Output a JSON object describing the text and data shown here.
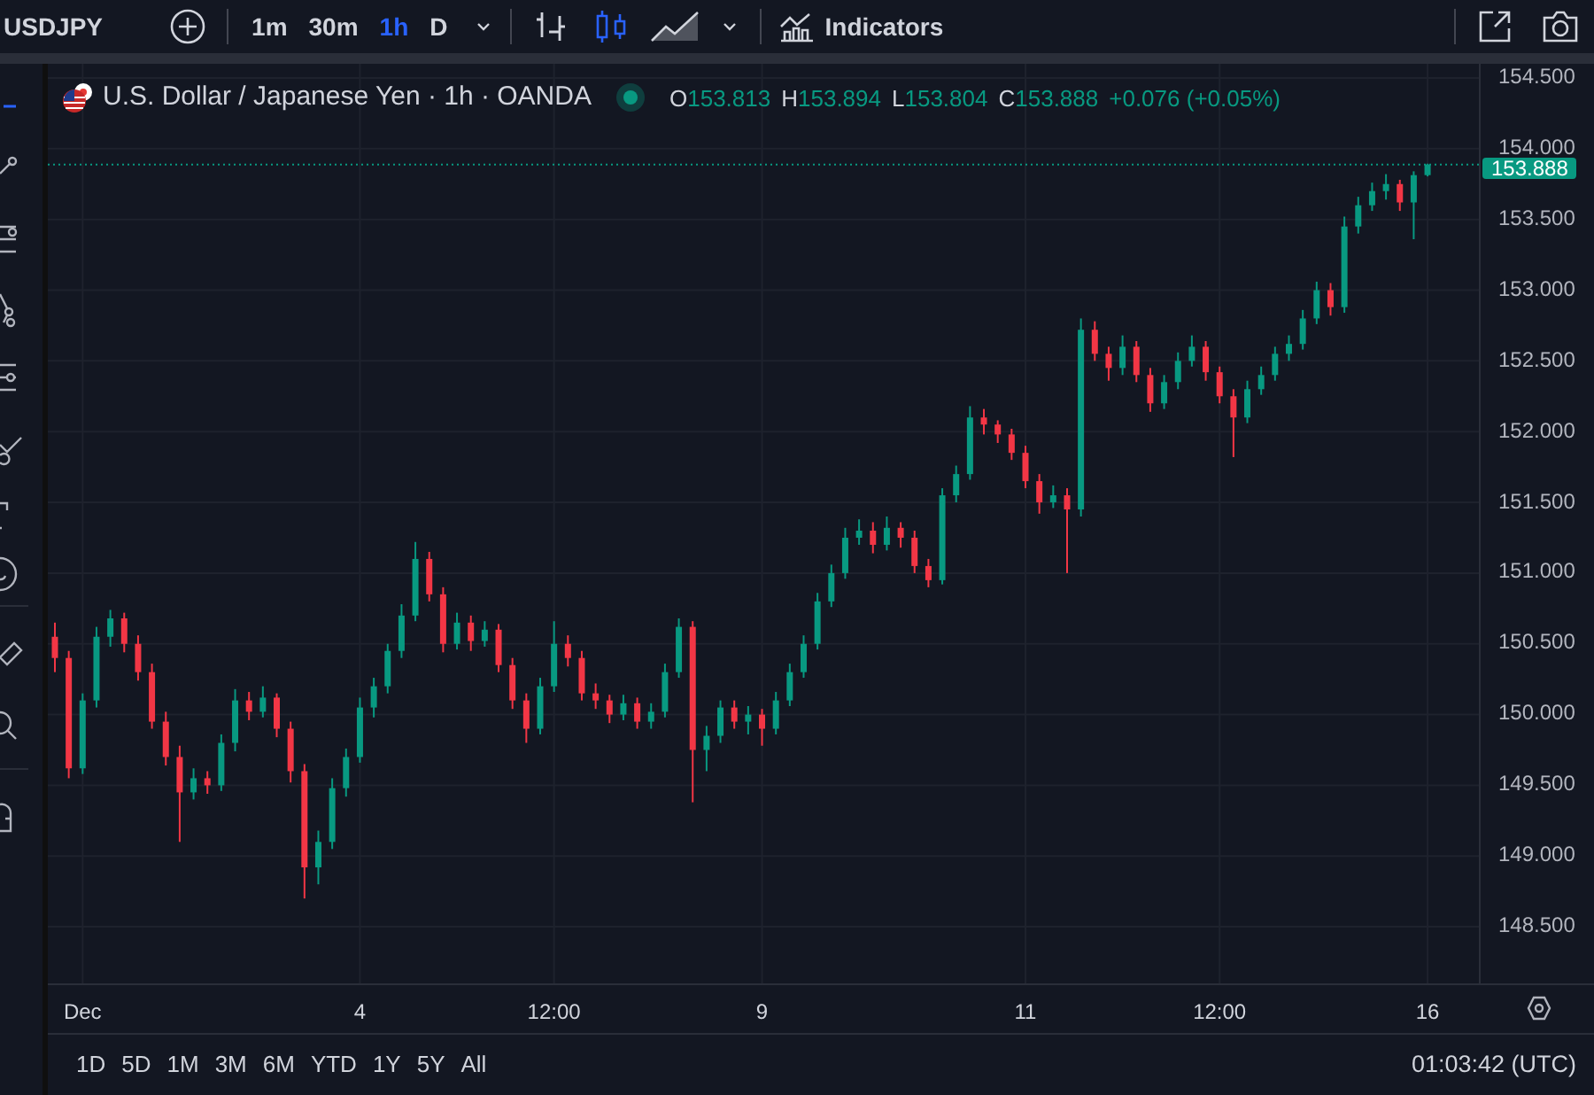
{
  "symbol": "USDJPY",
  "intervals": [
    {
      "label": "1m",
      "selected": false
    },
    {
      "label": "30m",
      "selected": false
    },
    {
      "label": "1h",
      "selected": true
    },
    {
      "label": "D",
      "selected": false
    }
  ],
  "chart_styles": [
    {
      "kind": "bars",
      "selected": false
    },
    {
      "kind": "candles",
      "selected": true
    },
    {
      "kind": "area",
      "selected": false
    }
  ],
  "indicators_button": "Indicators",
  "legend": {
    "title": "U.S. Dollar / Japanese Yen · 1h · OANDA",
    "market_open": true,
    "ohlc": [
      {
        "label": "O",
        "value": "153.813"
      },
      {
        "label": "H",
        "value": "153.894"
      },
      {
        "label": "L",
        "value": "153.804"
      },
      {
        "label": "C",
        "value": "153.888"
      }
    ],
    "change": "+0.076 (+0.05%)"
  },
  "chart": {
    "chart_data": {
      "type": "candlestick",
      "ylim": [
        148.1,
        154.6
      ],
      "grid": true,
      "ref_lines": [
        {
          "axis": "y",
          "value": 153.888,
          "label": "153.888",
          "color": "#089981"
        }
      ],
      "yticks": [
        {
          "value": 154.5,
          "label": "154.500"
        },
        {
          "value": 154,
          "label": "154.000"
        },
        {
          "value": 153.5,
          "label": "153.500"
        },
        {
          "value": 153,
          "label": "153.000"
        },
        {
          "value": 152.5,
          "label": "152.500"
        },
        {
          "value": 152,
          "label": "152.000"
        },
        {
          "value": 151.5,
          "label": "151.500"
        },
        {
          "value": 151,
          "label": "151.000"
        },
        {
          "value": 150.5,
          "label": "150.500"
        },
        {
          "value": 150,
          "label": "150.000"
        },
        {
          "value": 149.5,
          "label": "149.500"
        },
        {
          "value": 149,
          "label": "149.000"
        },
        {
          "value": 148.5,
          "label": "148.500"
        }
      ],
      "categories": [
        null,
        null,
        "Dec",
        null,
        null,
        null,
        null,
        null,
        null,
        null,
        null,
        null,
        null,
        null,
        null,
        null,
        null,
        null,
        null,
        null,
        null,
        null,
        "4",
        null,
        null,
        null,
        null,
        null,
        null,
        null,
        null,
        null,
        null,
        null,
        null,
        null,
        "12:00",
        null,
        null,
        null,
        null,
        null,
        null,
        null,
        null,
        null,
        null,
        null,
        null,
        null,
        null,
        "9",
        null,
        null,
        null,
        null,
        null,
        null,
        null,
        null,
        null,
        null,
        null,
        null,
        null,
        null,
        null,
        null,
        null,
        null,
        "11",
        null,
        null,
        null,
        null,
        null,
        null,
        null,
        null,
        null,
        null,
        null,
        null,
        null,
        "12:00",
        null,
        null,
        null,
        null,
        null,
        null,
        null,
        null,
        null,
        null,
        null,
        null,
        null,
        null,
        "16"
      ],
      "ohlc": [
        [
          150.55,
          150.65,
          150.3,
          150.4
        ],
        [
          150.4,
          150.45,
          149.55,
          149.62
        ],
        [
          149.62,
          150.15,
          149.58,
          150.1
        ],
        [
          150.1,
          150.62,
          150.05,
          150.55
        ],
        [
          150.55,
          150.74,
          150.48,
          150.68
        ],
        [
          150.68,
          150.72,
          150.44,
          150.5
        ],
        [
          150.5,
          150.56,
          150.24,
          150.3
        ],
        [
          150.3,
          150.36,
          149.9,
          149.95
        ],
        [
          149.95,
          150.02,
          149.64,
          149.7
        ],
        [
          149.7,
          149.78,
          149.1,
          149.45
        ],
        [
          149.45,
          149.62,
          149.4,
          149.55
        ],
        [
          149.55,
          149.6,
          149.44,
          149.5
        ],
        [
          149.5,
          149.86,
          149.46,
          149.8
        ],
        [
          149.8,
          150.18,
          149.74,
          150.1
        ],
        [
          150.1,
          150.16,
          149.96,
          150.02
        ],
        [
          150.02,
          150.2,
          149.98,
          150.12
        ],
        [
          150.12,
          150.15,
          149.84,
          149.9
        ],
        [
          149.9,
          149.95,
          149.52,
          149.6
        ],
        [
          149.6,
          149.65,
          148.7,
          148.92
        ],
        [
          148.92,
          149.18,
          148.8,
          149.1
        ],
        [
          149.1,
          149.55,
          149.05,
          149.48
        ],
        [
          149.48,
          149.76,
          149.42,
          149.7
        ],
        [
          149.7,
          150.12,
          149.66,
          150.05
        ],
        [
          150.05,
          150.26,
          149.98,
          150.2
        ],
        [
          150.2,
          150.5,
          150.15,
          150.45
        ],
        [
          150.45,
          150.78,
          150.4,
          150.7
        ],
        [
          150.7,
          151.22,
          150.66,
          151.1
        ],
        [
          151.1,
          151.15,
          150.8,
          150.85
        ],
        [
          150.85,
          150.9,
          150.44,
          150.5
        ],
        [
          150.5,
          150.72,
          150.46,
          150.65
        ],
        [
          150.65,
          150.7,
          150.45,
          150.52
        ],
        [
          150.52,
          150.66,
          150.48,
          150.6
        ],
        [
          150.6,
          150.64,
          150.3,
          150.35
        ],
        [
          150.35,
          150.4,
          150.04,
          150.1
        ],
        [
          150.1,
          150.15,
          149.8,
          149.9
        ],
        [
          149.9,
          150.26,
          149.86,
          150.2
        ],
        [
          150.2,
          150.66,
          150.16,
          150.5
        ],
        [
          150.5,
          150.56,
          150.34,
          150.4
        ],
        [
          150.4,
          150.45,
          150.1,
          150.15
        ],
        [
          150.15,
          150.22,
          150.04,
          150.1
        ],
        [
          150.1,
          150.14,
          149.94,
          150.0
        ],
        [
          150.0,
          150.14,
          149.96,
          150.08
        ],
        [
          150.08,
          150.12,
          149.9,
          149.95
        ],
        [
          149.95,
          150.08,
          149.9,
          150.02
        ],
        [
          150.02,
          150.36,
          149.98,
          150.3
        ],
        [
          150.3,
          150.68,
          150.26,
          150.62
        ],
        [
          150.62,
          150.66,
          149.38,
          149.75
        ],
        [
          149.75,
          149.92,
          149.6,
          149.85
        ],
        [
          149.85,
          150.1,
          149.8,
          150.05
        ],
        [
          150.05,
          150.1,
          149.9,
          149.95
        ],
        [
          149.95,
          150.06,
          149.86,
          150.0
        ],
        [
          150.0,
          150.04,
          149.78,
          149.9
        ],
        [
          149.9,
          150.16,
          149.86,
          150.1
        ],
        [
          150.1,
          150.36,
          150.06,
          150.3
        ],
        [
          150.3,
          150.56,
          150.26,
          150.5
        ],
        [
          150.5,
          150.86,
          150.46,
          150.8
        ],
        [
          150.8,
          151.06,
          150.76,
          151.0
        ],
        [
          151.0,
          151.32,
          150.96,
          151.25
        ],
        [
          151.25,
          151.38,
          151.2,
          151.3
        ],
        [
          151.3,
          151.36,
          151.14,
          151.2
        ],
        [
          151.2,
          151.4,
          151.16,
          151.32
        ],
        [
          151.32,
          151.36,
          151.18,
          151.25
        ],
        [
          151.25,
          151.3,
          151.0,
          151.05
        ],
        [
          151.05,
          151.1,
          150.9,
          150.95
        ],
        [
          150.95,
          151.6,
          150.92,
          151.55
        ],
        [
          151.55,
          151.76,
          151.5,
          151.7
        ],
        [
          151.7,
          152.18,
          151.66,
          152.1
        ],
        [
          152.1,
          152.16,
          151.98,
          152.05
        ],
        [
          152.05,
          152.08,
          151.92,
          151.98
        ],
        [
          151.98,
          152.02,
          151.8,
          151.85
        ],
        [
          151.85,
          151.9,
          151.6,
          151.65
        ],
        [
          151.65,
          151.7,
          151.42,
          151.5
        ],
        [
          151.5,
          151.62,
          151.46,
          151.55
        ],
        [
          151.55,
          151.6,
          151.0,
          151.45
        ],
        [
          151.45,
          152.8,
          151.4,
          152.72
        ],
        [
          152.72,
          152.78,
          152.5,
          152.55
        ],
        [
          152.55,
          152.6,
          152.36,
          152.45
        ],
        [
          152.45,
          152.68,
          152.4,
          152.6
        ],
        [
          152.6,
          152.64,
          152.35,
          152.4
        ],
        [
          152.4,
          152.45,
          152.14,
          152.2
        ],
        [
          152.2,
          152.4,
          152.16,
          152.35
        ],
        [
          152.35,
          152.56,
          152.3,
          152.5
        ],
        [
          152.5,
          152.68,
          152.46,
          152.6
        ],
        [
          152.6,
          152.64,
          152.36,
          152.42
        ],
        [
          152.42,
          152.46,
          152.2,
          152.25
        ],
        [
          152.25,
          152.3,
          151.82,
          152.1
        ],
        [
          152.1,
          152.36,
          152.06,
          152.3
        ],
        [
          152.3,
          152.46,
          152.26,
          152.4
        ],
        [
          152.4,
          152.6,
          152.36,
          152.55
        ],
        [
          152.55,
          152.68,
          152.5,
          152.62
        ],
        [
          152.62,
          152.86,
          152.58,
          152.8
        ],
        [
          152.8,
          153.06,
          152.76,
          153.0
        ],
        [
          153.0,
          153.05,
          152.82,
          152.88
        ],
        [
          152.88,
          153.52,
          152.84,
          153.45
        ],
        [
          153.45,
          153.66,
          153.4,
          153.6
        ],
        [
          153.6,
          153.76,
          153.56,
          153.7
        ],
        [
          153.7,
          153.82,
          153.64,
          153.75
        ],
        [
          153.75,
          153.78,
          153.56,
          153.62
        ],
        [
          153.62,
          153.84,
          153.36,
          153.813
        ],
        [
          153.813,
          153.894,
          153.804,
          153.888
        ]
      ]
    }
  },
  "ranges": [
    "1D",
    "5D",
    "1M",
    "3M",
    "6M",
    "YTD",
    "1Y",
    "5Y",
    "All"
  ],
  "clock": "01:03:42 (UTC)"
}
